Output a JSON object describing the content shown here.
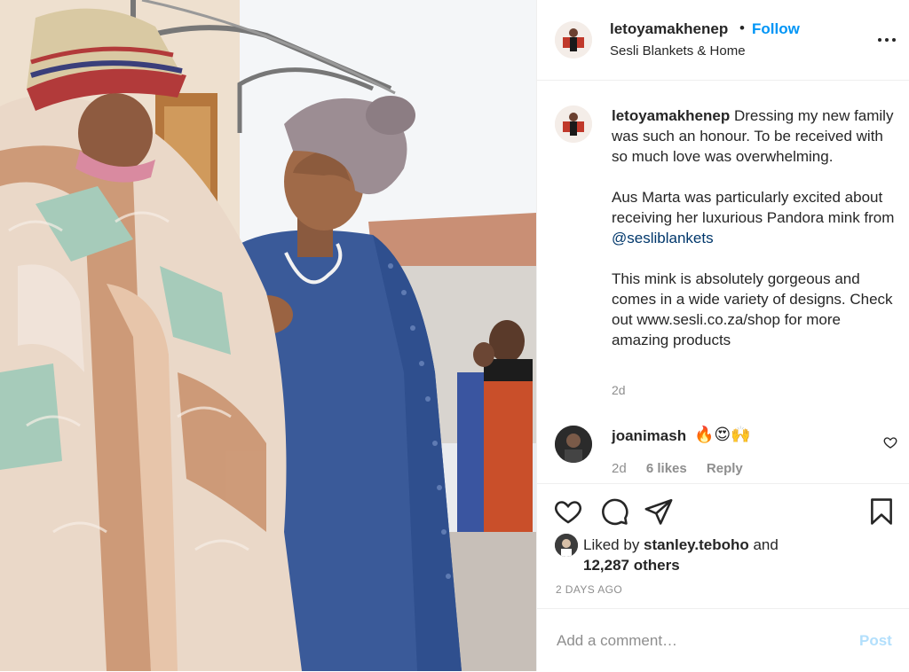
{
  "header": {
    "username": "letoyamakhenep",
    "separator": "•",
    "follow_label": "Follow",
    "location": "Sesli Blankets & Home"
  },
  "caption": {
    "username": "letoyamakhenep",
    "line1": "Dressing my new family was such an honour. To be received with so much love was overwhelming.",
    "line2_pre": "Aus Marta was particularly excited about receiving her luxurious Pandora mink from ",
    "mention": "@sesliblankets",
    "line3": "This mink is absolutely gorgeous and comes in a wide variety of designs. Check out www.sesli.co.za/shop for more amazing products",
    "age": "2d"
  },
  "comment": {
    "username": "joanimash",
    "text": "🔥😍🙌",
    "age": "2d",
    "likes": "6 likes",
    "reply_label": "Reply"
  },
  "actions": {
    "icons": [
      "heart-icon",
      "comment-icon",
      "share-icon",
      "bookmark-icon"
    ]
  },
  "likes": {
    "prefix": "Liked by ",
    "liker": "stanley.teboho",
    "mid": " and",
    "others": "12,287 others"
  },
  "timestamp": "2 DAYS AGO",
  "comment_bar": {
    "placeholder": "Add a comment…",
    "post_label": "Post"
  },
  "colors": {
    "accent": "#0095f6",
    "mention": "#00376b",
    "muted": "#8e8e8e",
    "post_disabled": "#b2dffc"
  }
}
